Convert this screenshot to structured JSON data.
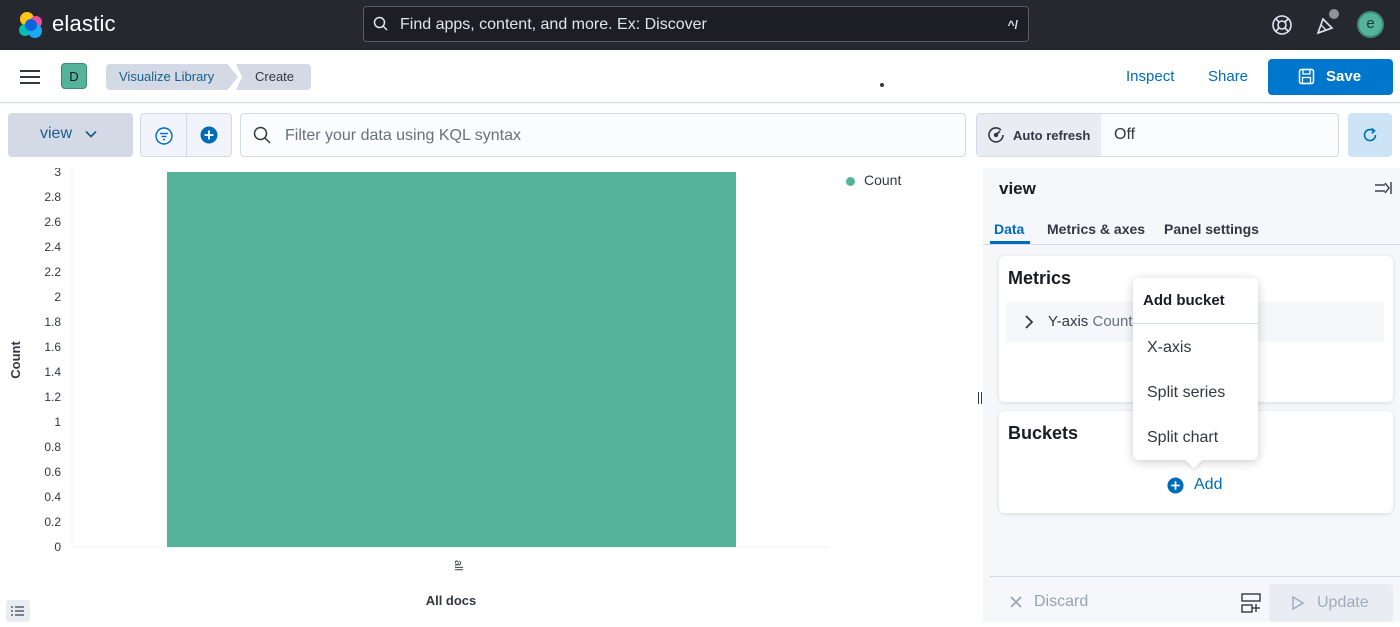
{
  "header": {
    "brand": "elastic",
    "search_placeholder": "Find apps, content, and more. Ex: Discover",
    "search_shortcut": "^/",
    "avatar_letter": "e"
  },
  "appbar": {
    "space_letter": "D",
    "breadcrumbs": [
      "Visualize Library",
      "Create"
    ],
    "inspect": "Inspect",
    "share": "Share",
    "save": "Save"
  },
  "query": {
    "dataview": "view",
    "kql_placeholder": "Filter your data using KQL syntax",
    "auto_refresh_label": "Auto refresh",
    "auto_refresh_value": "Off"
  },
  "chart_data": {
    "type": "bar",
    "categories": [
      "All docs"
    ],
    "series": [
      {
        "name": "Count",
        "values": [
          3
        ],
        "color": "#54b399"
      }
    ],
    "xlabel": "All docs",
    "ylabel": "Count",
    "ylim": [
      0,
      3
    ],
    "yticks": [
      "0",
      "0.2",
      "0.4",
      "0.6",
      "0.8",
      "1",
      "1.2",
      "1.4",
      "1.6",
      "1.8",
      "2",
      "2.2",
      "2.4",
      "2.6",
      "2.8",
      "3"
    ],
    "xtick_label": "all",
    "legend": "top-right"
  },
  "panel": {
    "title": "view",
    "tabs": [
      "Data",
      "Metrics & axes",
      "Panel settings"
    ],
    "metrics_title": "Metrics",
    "metric_item": "Y-axis",
    "metric_item_type": "Count",
    "buckets_title": "Buckets",
    "add_label": "Add",
    "popover_title": "Add bucket",
    "popover_items": [
      "X-axis",
      "Split series",
      "Split chart"
    ],
    "discard": "Discard",
    "update": "Update"
  }
}
